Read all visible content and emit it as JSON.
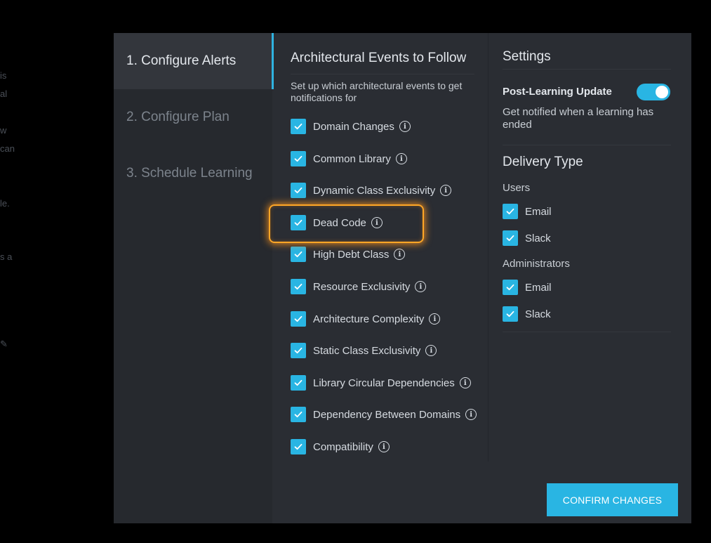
{
  "background": {
    "fragments": [
      "is",
      "al",
      "w",
      "can",
      "le.",
      "s a"
    ]
  },
  "steps": [
    {
      "label": "1. Configure Alerts",
      "active": true
    },
    {
      "label": "2. Configure Plan",
      "active": false
    },
    {
      "label": "3. Schedule Learning",
      "active": false
    }
  ],
  "events": {
    "title": "Architectural Events to Follow",
    "description": "Set up which architectural events to get notifications for",
    "items": [
      {
        "label": "Domain Changes",
        "checked": true
      },
      {
        "label": "Common Library",
        "checked": true
      },
      {
        "label": "Dynamic Class Exclusivity",
        "checked": true
      },
      {
        "label": "Dead Code",
        "checked": true,
        "highlighted": true
      },
      {
        "label": "High Debt Class",
        "checked": true
      },
      {
        "label": "Resource Exclusivity",
        "checked": true
      },
      {
        "label": "Architecture Complexity",
        "checked": true
      },
      {
        "label": "Static Class Exclusivity",
        "checked": true
      },
      {
        "label": "Library Circular Dependencies",
        "checked": true
      },
      {
        "label": "Dependency Between Domains",
        "checked": true
      },
      {
        "label": "Compatibility",
        "checked": true
      }
    ],
    "info_icon_glyph": "i"
  },
  "settings": {
    "title": "Settings",
    "post_learning": {
      "label": "Post-Learning Update",
      "enabled": true,
      "description": "Get notified when a learning has ended"
    },
    "delivery": {
      "title": "Delivery Type",
      "groups": [
        {
          "label": "Users",
          "options": [
            {
              "label": "Email",
              "checked": true
            },
            {
              "label": "Slack",
              "checked": true
            }
          ]
        },
        {
          "label": "Administrators",
          "options": [
            {
              "label": "Email",
              "checked": true
            },
            {
              "label": "Slack",
              "checked": true
            }
          ]
        }
      ]
    }
  },
  "confirm_label": "CONFIRM CHANGES",
  "colors": {
    "accent": "#29b5e3",
    "highlight": "#ffa726",
    "panel": "#2a2d33",
    "sidebar": "#26292e"
  }
}
